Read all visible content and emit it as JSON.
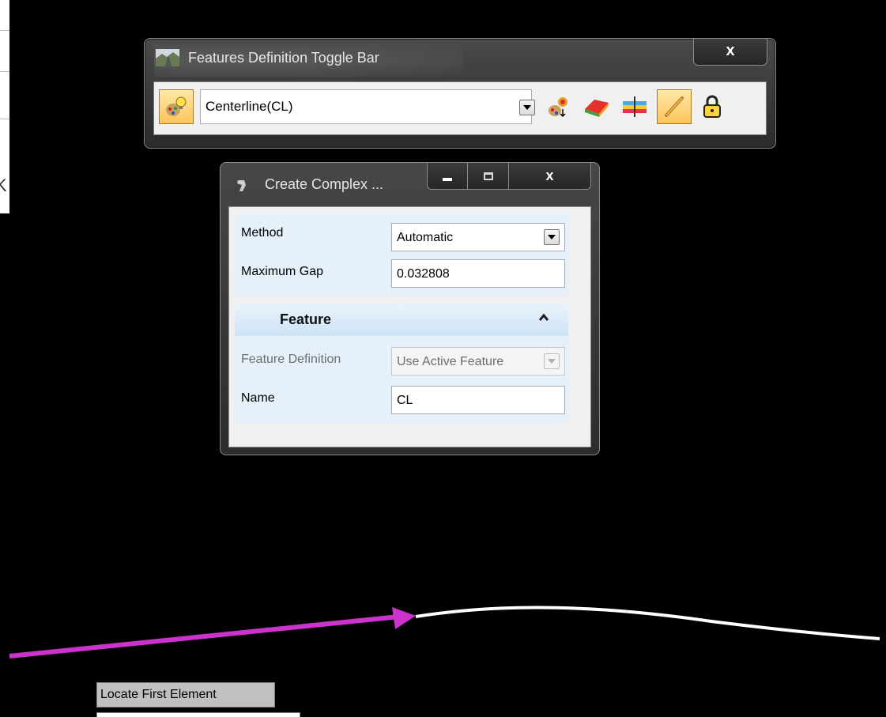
{
  "toggle_bar": {
    "title": "Features Definition Toggle Bar",
    "close_label": "x",
    "active_feature": "Centerline(CL)"
  },
  "create_complex": {
    "title": "Create Complex ...",
    "close_label": "x",
    "method_label": "Method",
    "method_value": "Automatic",
    "gap_label": "Maximum Gap",
    "gap_value": "0.032808",
    "feature_section": "Feature",
    "feature_def_label": "Feature Definition",
    "feature_def_value": "Use Active Feature",
    "name_label": "Name",
    "name_value": "CL"
  },
  "status": {
    "prompt": "Locate First Element"
  },
  "colors": {
    "element_highlight": "#cc33cc",
    "element": "#ffffff",
    "background": "#000000"
  },
  "icons": [
    "feature-toggle-icon",
    "pick-feature-icon",
    "surface-mesh-icon",
    "profile-section-icon",
    "link-feature-icon",
    "lock-icon"
  ]
}
